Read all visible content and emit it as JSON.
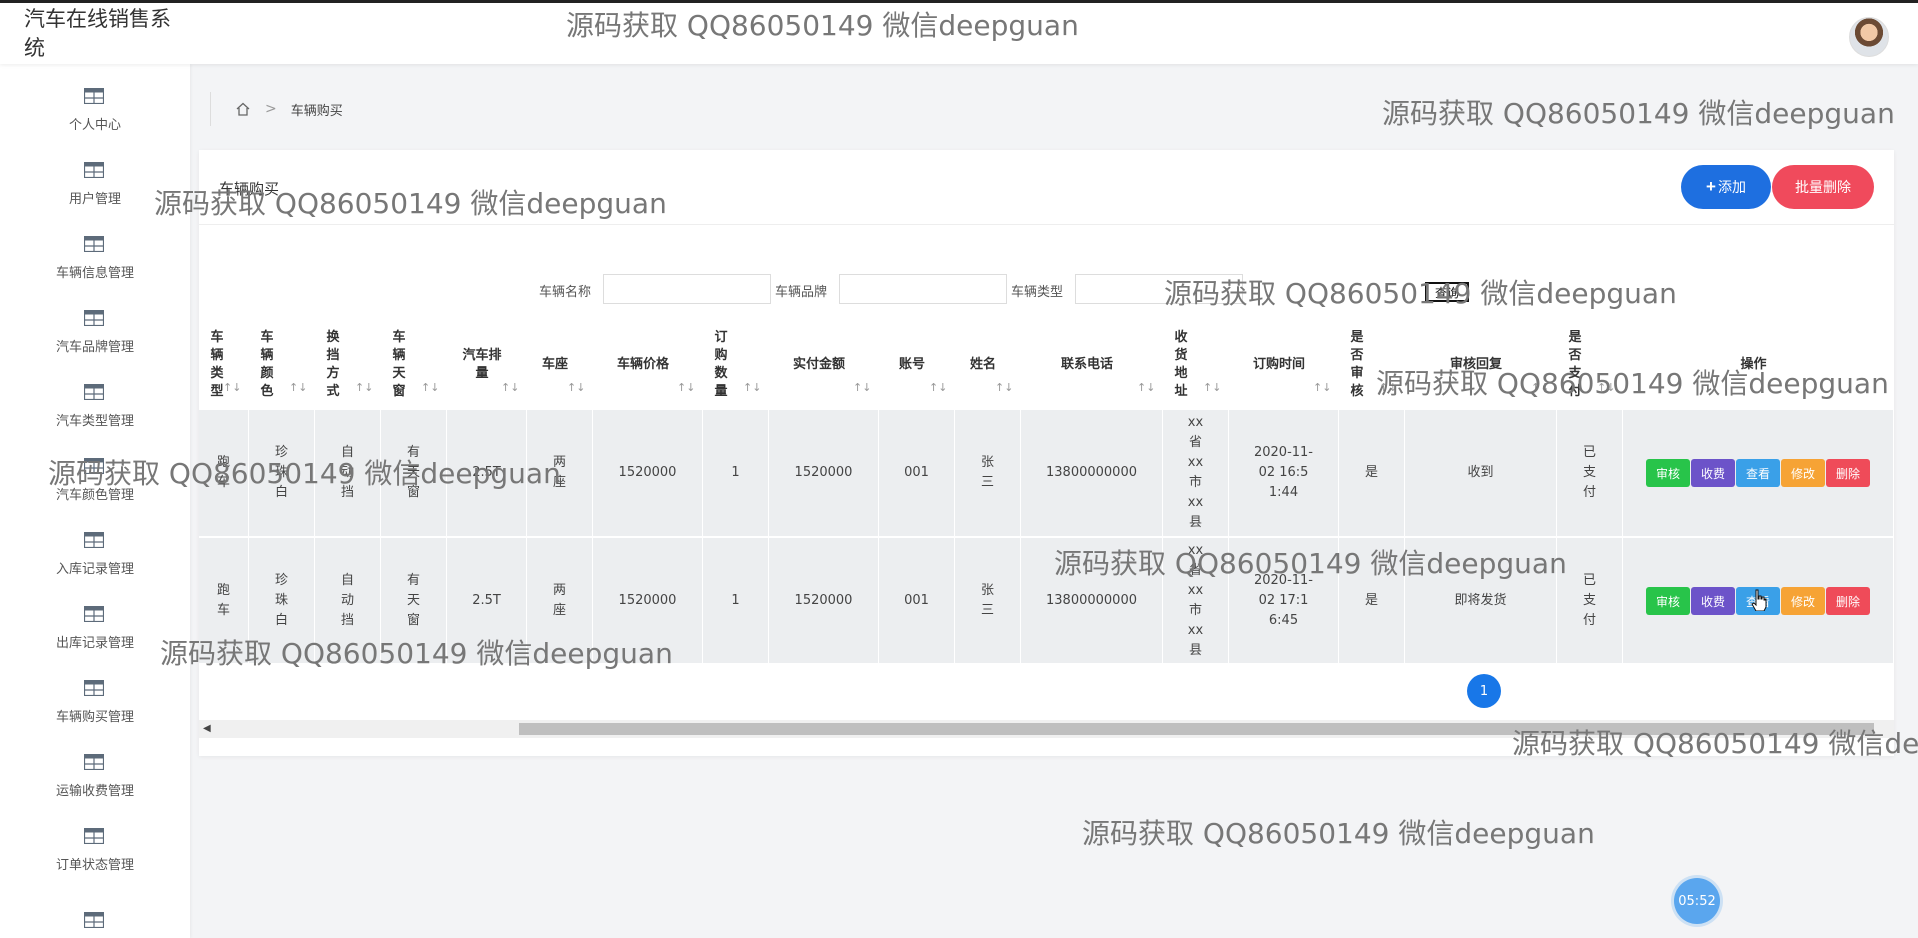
{
  "app": {
    "title": "汽车在线销售系统"
  },
  "sidebar": {
    "items": [
      {
        "label": "个人中心"
      },
      {
        "label": "用户管理"
      },
      {
        "label": "车辆信息管理"
      },
      {
        "label": "汽车品牌管理"
      },
      {
        "label": "汽车类型管理"
      },
      {
        "label": "汽车颜色管理"
      },
      {
        "label": "入库记录管理"
      },
      {
        "label": "出库记录管理"
      },
      {
        "label": "车辆购买管理"
      },
      {
        "label": "运输收费管理"
      },
      {
        "label": "订单状态管理"
      }
    ]
  },
  "breadcrumb": {
    "current": "车辆购买"
  },
  "card": {
    "title": "车辆购买",
    "add_label": "添加",
    "batch_delete_label": "批量删除"
  },
  "search": {
    "name_label": "车辆名称",
    "brand_label": "车辆品牌",
    "type_label": "车辆类型",
    "query_label": "查询"
  },
  "table": {
    "headers": [
      "车辆类型",
      "车辆颜色",
      "换挡方式",
      "车辆天窗",
      "汽车排量",
      "车座",
      "车辆价格",
      "订购数量",
      "实付金额",
      "账号",
      "姓名",
      "联系电话",
      "收货地址",
      "订购时间",
      "是否审核",
      "审核回复",
      "是否支付",
      "操作"
    ],
    "sort_icon": "↑↓",
    "rows": [
      [
        "跑车",
        "珍珠白",
        "自动挡",
        "有天窗",
        "2.5T",
        "两座",
        "1520000",
        "1",
        "1520000",
        "001",
        "张三",
        "13800000000",
        "xx省xx市xx县",
        "2020-11-02 16:51:44",
        "是",
        "收到",
        "已支付"
      ],
      [
        "跑车",
        "珍珠白",
        "自动挡",
        "有天窗",
        "2.5T",
        "两座",
        "1520000",
        "1",
        "1520000",
        "001",
        "张三",
        "13800000000",
        "xx省xx市xx县",
        "2020-11-02 17:16:45",
        "是",
        "即将发货",
        "已支付"
      ]
    ],
    "actions": [
      "审核",
      "收费",
      "查看",
      "修改",
      "删除"
    ]
  },
  "pagination": {
    "current_page": "1"
  },
  "timer": {
    "text": "05:52"
  },
  "watermark": {
    "text": "源码获取 QQ86050149 微信deepguan"
  },
  "colors": {
    "primary": "#1e6fe0",
    "danger": "#f04a5c",
    "audit": "#28c44a",
    "pay": "#6c53c9",
    "view": "#3aa0e8",
    "edit": "#f6a335"
  }
}
